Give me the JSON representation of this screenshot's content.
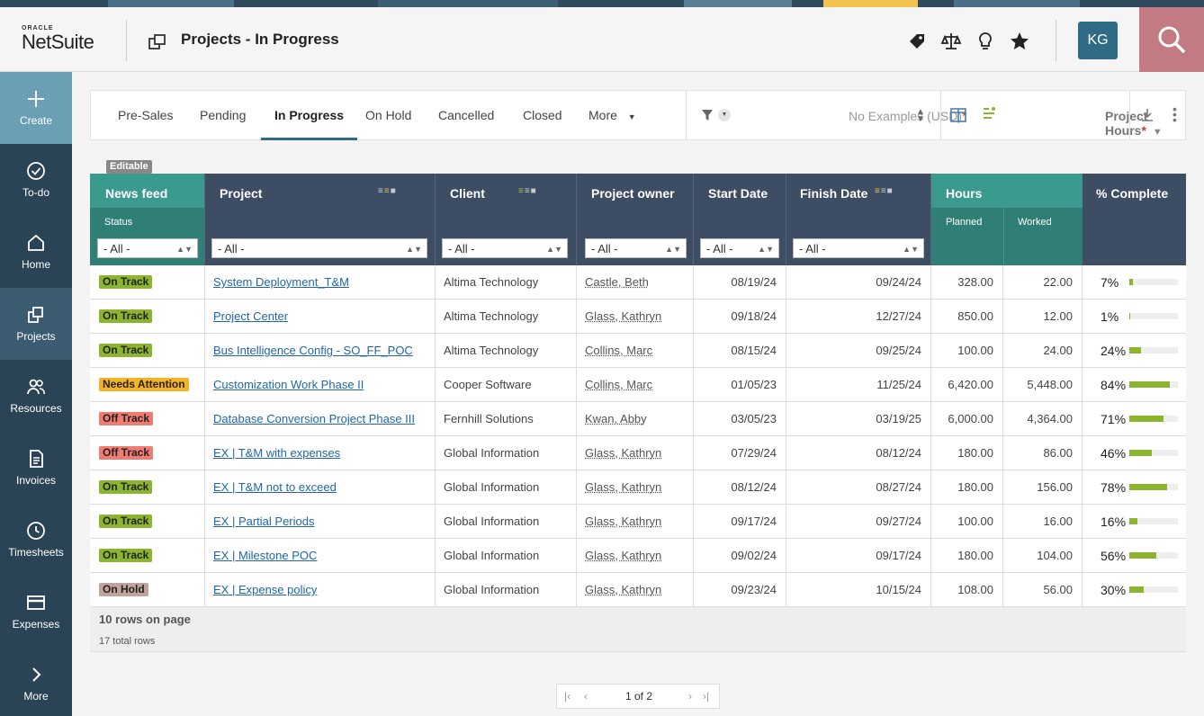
{
  "header": {
    "logo_brand": "ORACLE",
    "logo_product": "NetSuite",
    "page_title": "Projects - In Progress",
    "avatar_initials": "KG",
    "icons": [
      "tag-icon",
      "balance-icon",
      "lightbulb-icon",
      "star-icon",
      "search-icon"
    ]
  },
  "sidebar": {
    "items": [
      {
        "label": "Create",
        "icon": "plus-icon"
      },
      {
        "label": "To-do",
        "icon": "check-circle-icon"
      },
      {
        "label": "Home",
        "icon": "home-icon"
      },
      {
        "label": "Projects",
        "icon": "projects-icon"
      },
      {
        "label": "Resources",
        "icon": "people-icon"
      },
      {
        "label": "Invoices",
        "icon": "invoice-icon"
      },
      {
        "label": "Timesheets",
        "icon": "clock-icon"
      },
      {
        "label": "Expenses",
        "icon": "card-icon"
      },
      {
        "label": "More",
        "icon": "chevron-right-icon"
      }
    ]
  },
  "tabs": {
    "items": [
      "Pre-Sales",
      "Pending",
      "In Progress",
      "On Hold",
      "Cancelled",
      "Closed",
      "More"
    ],
    "active": "In Progress",
    "currency_select": "No Examples (USD)",
    "required_mark": "*",
    "view_select": "Project Hours"
  },
  "editable_tag": "Editable",
  "table": {
    "columns": {
      "news_feed": "News feed",
      "status": "Status",
      "project": "Project",
      "client": "Client",
      "owner": "Project owner",
      "start": "Start Date",
      "finish": "Finish Date",
      "hours": "Hours",
      "planned": "Planned",
      "worked": "Worked",
      "complete": "% Complete"
    },
    "filter_all": "- All -",
    "rows": [
      {
        "status": "On Track",
        "project": "System Deployment_T&M",
        "client": "Altima Technology",
        "owner": "Castle, Beth",
        "start": "08/19/24",
        "finish": "09/24/24",
        "planned": "328.00",
        "worked": "22.00",
        "pct": "7%",
        "pct_value": 7
      },
      {
        "status": "On Track",
        "project": "Project Center",
        "client": "Altima Technology",
        "owner": "Glass, Kathryn",
        "start": "09/18/24",
        "finish": "12/27/24",
        "planned": "850.00",
        "worked": "12.00",
        "pct": "1%",
        "pct_value": 1
      },
      {
        "status": "On Track",
        "project": "Bus Intelligence Config - SO_FF_POC",
        "client": "Altima Technology",
        "owner": "Collins, Marc",
        "start": "08/15/24",
        "finish": "09/25/24",
        "planned": "100.00",
        "worked": "24.00",
        "pct": "24%",
        "pct_value": 24
      },
      {
        "status": "Needs Attention",
        "project": "Customization Work Phase II",
        "client": "Cooper Software",
        "owner": "Collins, Marc",
        "start": "01/05/23",
        "finish": "11/25/24",
        "planned": "6,420.00",
        "worked": "5,448.00",
        "pct": "84%",
        "pct_value": 84
      },
      {
        "status": "Off Track",
        "project": "Database Conversion Project Phase III",
        "client": "Fernhill Solutions",
        "owner": "Kwan, Abby",
        "start": "03/05/23",
        "finish": "03/19/25",
        "planned": "6,000.00",
        "worked": "4,364.00",
        "pct": "71%",
        "pct_value": 71
      },
      {
        "status": "Off Track",
        "project": "EX | T&M with expenses",
        "client": "Global Information",
        "owner": "Glass, Kathryn",
        "start": "07/29/24",
        "finish": "08/12/24",
        "planned": "180.00",
        "worked": "86.00",
        "pct": "46%",
        "pct_value": 46
      },
      {
        "status": "On Track",
        "project": "EX | T&M not to exceed",
        "client": "Global Information",
        "owner": "Glass, Kathryn",
        "start": "08/12/24",
        "finish": "08/27/24",
        "planned": "180.00",
        "worked": "156.00",
        "pct": "78%",
        "pct_value": 78
      },
      {
        "status": "On Track",
        "project": "EX | Partial Periods",
        "client": "Global Information",
        "owner": "Glass, Kathryn",
        "start": "09/17/24",
        "finish": "09/27/24",
        "planned": "100.00",
        "worked": "16.00",
        "pct": "16%",
        "pct_value": 16
      },
      {
        "status": "On Track",
        "project": "EX | Milestone POC",
        "client": "Global Information",
        "owner": "Glass, Kathryn",
        "start": "09/02/24",
        "finish": "09/17/24",
        "planned": "180.00",
        "worked": "104.00",
        "pct": "56%",
        "pct_value": 56
      },
      {
        "status": "On Hold",
        "project": "EX | Expense policy",
        "client": "Global Information",
        "owner": "Glass, Kathryn",
        "start": "09/23/24",
        "finish": "10/15/24",
        "planned": "108.00",
        "worked": "56.00",
        "pct": "30%",
        "pct_value": 30
      }
    ],
    "footer_rows": "10 rows on page",
    "footer_total": "17 total rows"
  },
  "status_colors": {
    "On Track": "#8bb52f",
    "Needs Attention": "#f5b323",
    "Off Track": "#ef7b72",
    "On Hold": "#c2a39a"
  },
  "pager": {
    "label": "1 of 2"
  }
}
